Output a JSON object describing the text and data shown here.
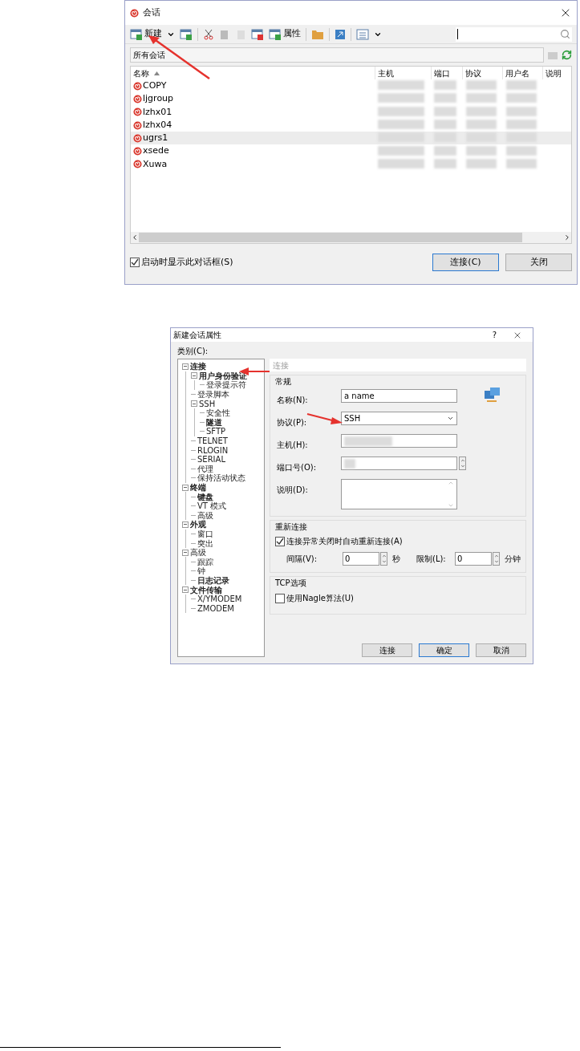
{
  "sessions_dialog": {
    "title": "会话",
    "toolbar": {
      "new_label": "新建",
      "properties_label": "属性"
    },
    "path": "所有会话",
    "columns": [
      "名称",
      "主机",
      "端口",
      "协议",
      "用户名",
      "说明"
    ],
    "rows": [
      {
        "name": "COPY",
        "selected": false
      },
      {
        "name": "ljgroup",
        "selected": false
      },
      {
        "name": "lzhx01",
        "selected": false
      },
      {
        "name": "lzhx04",
        "selected": false
      },
      {
        "name": "ugrs1",
        "selected": true
      },
      {
        "name": "xsede",
        "selected": false
      },
      {
        "name": "Xuwa",
        "selected": false
      }
    ],
    "startup_checkbox": {
      "label": "启动时显示此对话框(S)",
      "checked": true
    },
    "buttons": [
      {
        "label": "连接(C)",
        "default": true
      },
      {
        "label": "关闭",
        "default": false
      }
    ]
  },
  "properties_dialog": {
    "title": "新建会话属性",
    "help": "?",
    "category_label": "类别(C):",
    "tree": [
      {
        "label": "连接",
        "bold": true,
        "expanded": true,
        "children": [
          {
            "label": "用户身份验证",
            "bold": true,
            "expanded": true,
            "children": [
              {
                "label": "登录提示符",
                "bold": false
              }
            ]
          },
          {
            "label": "登录脚本",
            "bold": false
          },
          {
            "label": "SSH",
            "bold": false,
            "expanded": true,
            "children": [
              {
                "label": "安全性",
                "bold": false
              },
              {
                "label": "隧道",
                "bold": true
              },
              {
                "label": "SFTP",
                "bold": false
              }
            ]
          },
          {
            "label": "TELNET",
            "bold": false
          },
          {
            "label": "RLOGIN",
            "bold": false
          },
          {
            "label": "SERIAL",
            "bold": false
          },
          {
            "label": "代理",
            "bold": false
          },
          {
            "label": "保持活动状态",
            "bold": false
          }
        ]
      },
      {
        "label": "终端",
        "bold": true,
        "expanded": true,
        "children": [
          {
            "label": "键盘",
            "bold": true
          },
          {
            "label": "VT 模式",
            "bold": false
          },
          {
            "label": "高级",
            "bold": false
          }
        ]
      },
      {
        "label": "外观",
        "bold": true,
        "expanded": true,
        "children": [
          {
            "label": "窗口",
            "bold": false
          },
          {
            "label": "突出",
            "bold": false
          }
        ]
      },
      {
        "label": "高级",
        "bold": false,
        "expanded": true,
        "children": [
          {
            "label": "跟踪",
            "bold": false
          },
          {
            "label": "钟",
            "bold": false
          },
          {
            "label": "日志记录",
            "bold": true
          }
        ]
      },
      {
        "label": "文件传输",
        "bold": true,
        "expanded": true,
        "children": [
          {
            "label": "X/YMODEM",
            "bold": false
          },
          {
            "label": "ZMODEM",
            "bold": false
          }
        ]
      }
    ],
    "header": "连接",
    "general": {
      "title": "常规",
      "fields": [
        {
          "label": "名称(N):",
          "kind": "text",
          "value": "a name"
        },
        {
          "label": "协议(P):",
          "kind": "select",
          "value": "SSH"
        },
        {
          "label": "主机(H):",
          "kind": "redacted"
        },
        {
          "label": "端口号(O):",
          "kind": "redacted_spin"
        },
        {
          "label": "说明(D):",
          "kind": "textarea"
        }
      ]
    },
    "reconnect": {
      "title": "重新连接",
      "checkbox": {
        "label": "连接异常关闭时自动重新连接(A)",
        "checked": true
      },
      "interval_label": "间隔(V):",
      "interval_value": "0",
      "interval_unit": "秒",
      "limit_label": "限制(L):",
      "limit_value": "0",
      "limit_unit": "分钟"
    },
    "tcp": {
      "title": "TCP选项",
      "checkbox": {
        "label": "使用Nagle算法(U)",
        "checked": false
      }
    },
    "buttons": [
      {
        "label": "连接",
        "default": false
      },
      {
        "label": "确定",
        "default": true
      },
      {
        "label": "取消",
        "default": false
      }
    ]
  }
}
